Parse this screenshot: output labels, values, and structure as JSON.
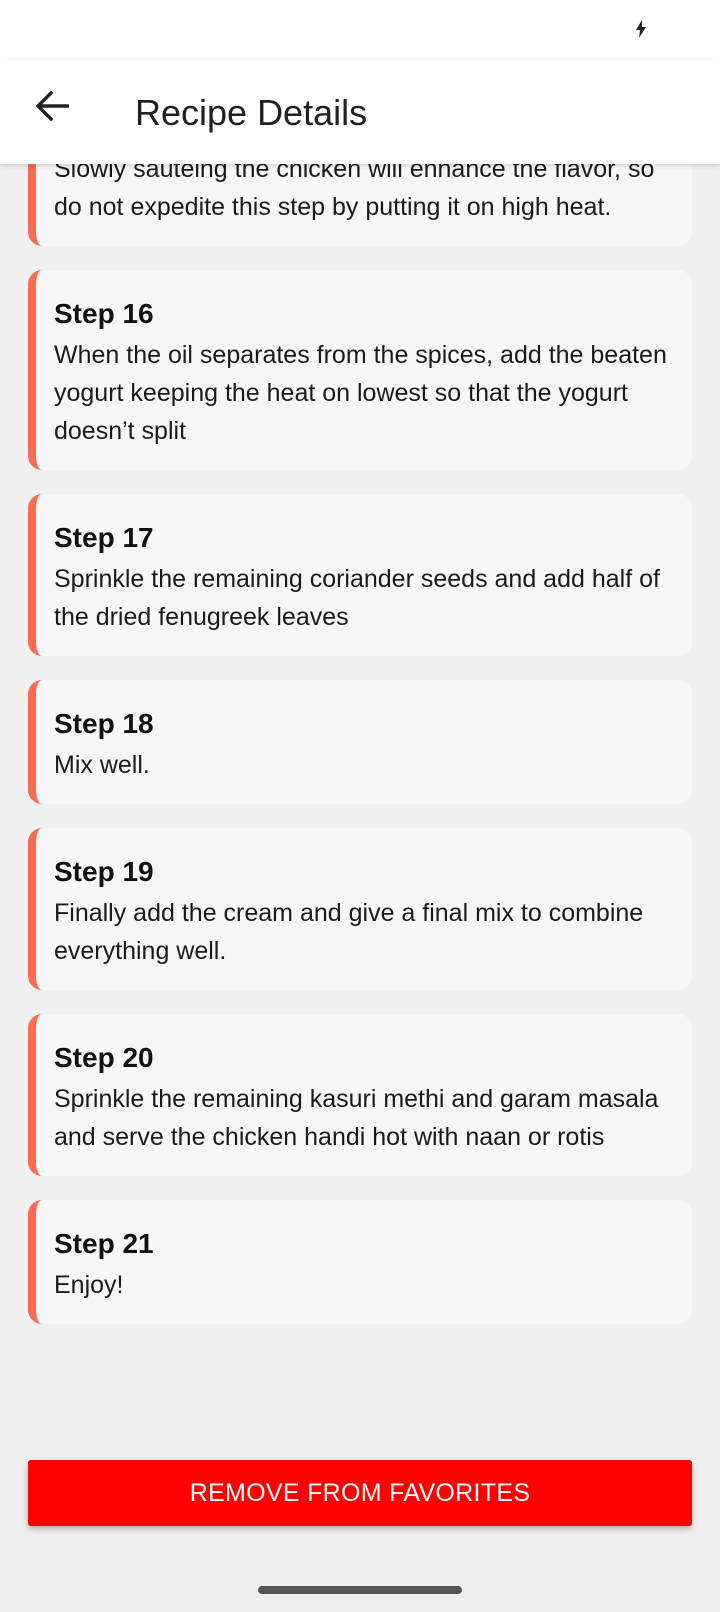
{
  "status_bar": {
    "icons": [
      "battery-charging-icon"
    ]
  },
  "app_bar": {
    "back_icon": "arrow-left-icon",
    "title": "Recipe Details"
  },
  "steps": [
    {
      "title": "",
      "text": "Slowly sautéing the chicken will enhance the flavor, so do not expedite this step by putting it on high heat."
    },
    {
      "title": "Step 16",
      "text": "When the oil separates from the spices, add the beaten yogurt keeping the heat on lowest so that the yogurt doesn’t split"
    },
    {
      "title": "Step 17",
      "text": "Sprinkle the remaining coriander seeds and add half of the dried fenugreek leaves"
    },
    {
      "title": "Step 18",
      "text": "Mix well."
    },
    {
      "title": "Step 19",
      "text": "Finally add the cream and give a final mix to combine everything well."
    },
    {
      "title": "Step 20",
      "text": "Sprinkle the remaining kasuri methi and garam masala and serve the chicken handi hot with naan or rotis"
    },
    {
      "title": "Step 21",
      "text": "Enjoy!"
    }
  ],
  "actions": {
    "remove_favorites_label": "REMOVE FROM FAVORITES"
  },
  "colors": {
    "accent_border": "#ff6b52",
    "button_bg": "#ff0000",
    "card_bg": "#f7f7f7",
    "page_bg": "#f0f0f0"
  }
}
